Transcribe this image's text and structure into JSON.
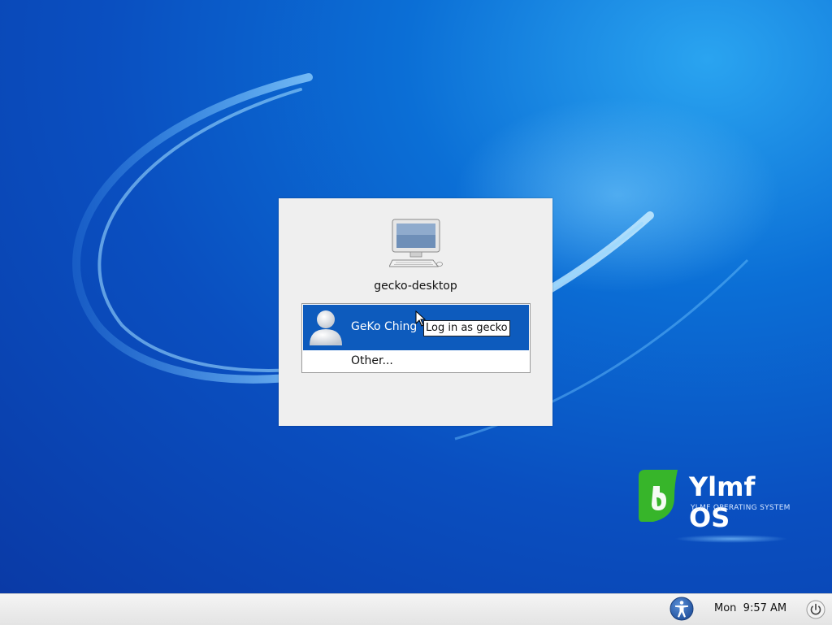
{
  "login": {
    "hostname": "gecko-desktop",
    "users": [
      {
        "name": "GeKo Ching",
        "selected": true,
        "icon": "user-avatar-icon"
      },
      {
        "name": "Other...",
        "selected": false
      }
    ],
    "tooltip": "Log in as gecko"
  },
  "brand": {
    "name": "Ylmf OS",
    "tagline": "YLMF OPERATING SYSTEM",
    "accent_color": "#3dbb2e"
  },
  "panel": {
    "clock": "Mon  9:57 AM",
    "accessibility_icon": "accessibility-icon",
    "power_icon": "power-icon"
  },
  "colors": {
    "selection": "#0d5bbd",
    "dialog_bg": "#efefef",
    "desktop_blue": "#0a4fc0"
  }
}
